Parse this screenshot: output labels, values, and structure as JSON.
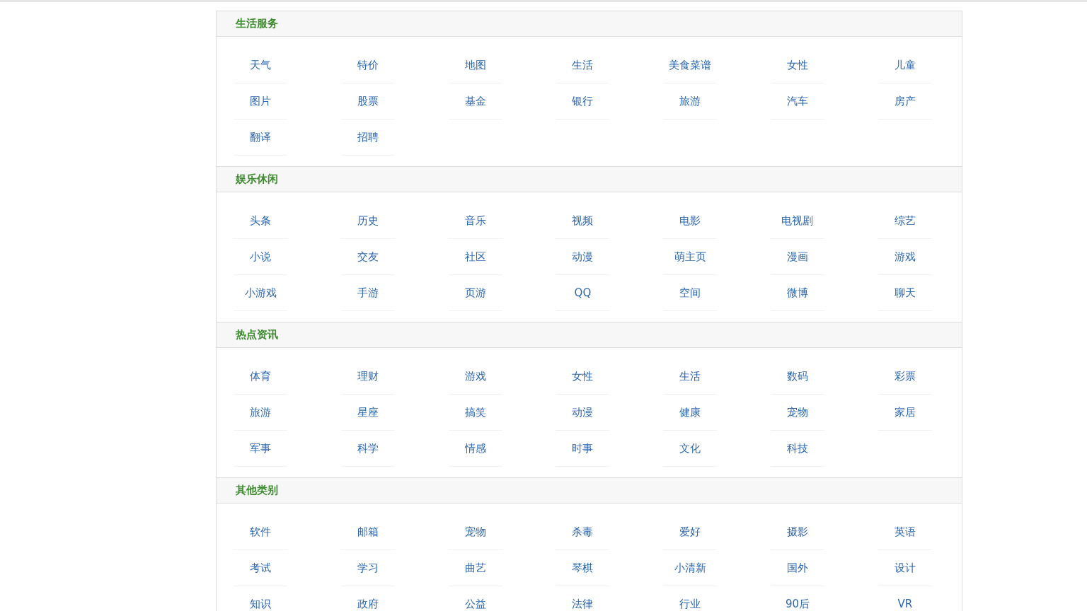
{
  "sections": [
    {
      "title": "生活服务",
      "links": [
        "天气",
        "特价",
        "地图",
        "生活",
        "美食菜谱",
        "女性",
        "儿童",
        "图片",
        "股票",
        "基金",
        "银行",
        "旅游",
        "汽车",
        "房产",
        "翻译",
        "招聘"
      ]
    },
    {
      "title": "娱乐休闲",
      "links": [
        "头条",
        "历史",
        "音乐",
        "视频",
        "电影",
        "电视剧",
        "综艺",
        "小说",
        "交友",
        "社区",
        "动漫",
        "萌主页",
        "漫画",
        "游戏",
        "小游戏",
        "手游",
        "页游",
        "QQ",
        "空间",
        "微博",
        "聊天"
      ]
    },
    {
      "title": "热点资讯",
      "links": [
        "体育",
        "理财",
        "游戏",
        "女性",
        "生活",
        "数码",
        "彩票",
        "旅游",
        "星座",
        "搞笑",
        "动漫",
        "健康",
        "宠物",
        "家居",
        "军事",
        "科学",
        "情感",
        "时事",
        "文化",
        "科技"
      ]
    },
    {
      "title": "其他类别",
      "links": [
        "软件",
        "邮箱",
        "宠物",
        "杀毒",
        "爱好",
        "摄影",
        "英语",
        "考试",
        "学习",
        "曲艺",
        "琴棋",
        "小清新",
        "国外",
        "设计",
        "知识",
        "政府",
        "公益",
        "法律",
        "行业",
        "90后",
        "VR"
      ]
    }
  ]
}
